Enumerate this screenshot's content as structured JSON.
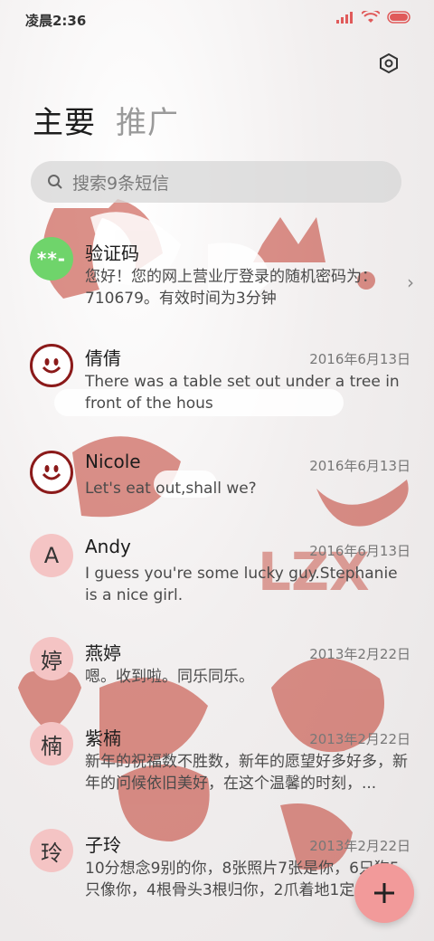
{
  "status": {
    "time": "凌晨2:36"
  },
  "tabs": [
    {
      "label": "主要"
    },
    {
      "label": "推广"
    }
  ],
  "search": {
    "placeholder": "搜索9条短信"
  },
  "conversations": [
    {
      "avatar": "**-",
      "name": "验证码",
      "date": "",
      "preview": "您好！您的网上营业厅登录的随机密码为：710679。有效时间为3分钟"
    },
    {
      "avatar": "smile",
      "name": "倩倩",
      "date": "2016年6月13日",
      "preview": "There was a table set out under a tree in front of the hous"
    },
    {
      "avatar": "smile",
      "name": "Nicole",
      "date": "2016年6月13日",
      "preview": "Let's eat out,shall we?"
    },
    {
      "avatar": "A",
      "name": "Andy",
      "date": "2016年6月13日",
      "preview": "I guess you're some lucky guy.Stephanie is a nice girl."
    },
    {
      "avatar": "婷",
      "name": "燕婷",
      "date": "2013年2月22日",
      "preview": "嗯。收到啦。同乐同乐。"
    },
    {
      "avatar": "楠",
      "name": "紫楠",
      "date": "2013年2月22日",
      "preview": "新年的祝福数不胜数，新年的愿望好多好多，新年的问候依旧美好，在这个温馨的时刻，..."
    },
    {
      "avatar": "玲",
      "name": "子玲",
      "date": "2013年2月22日",
      "preview": "10分想念9别的你，8张照片7张是你，6只狗5只像你，4根骨头3根归你，2爪着地1定是你"
    }
  ],
  "wallpaper_text": {
    "lzx": "LZX"
  },
  "colors": {
    "accent": "#f29a9a",
    "avatar_pink": "#f4c4c4",
    "verify_green": "#6fd46b"
  }
}
